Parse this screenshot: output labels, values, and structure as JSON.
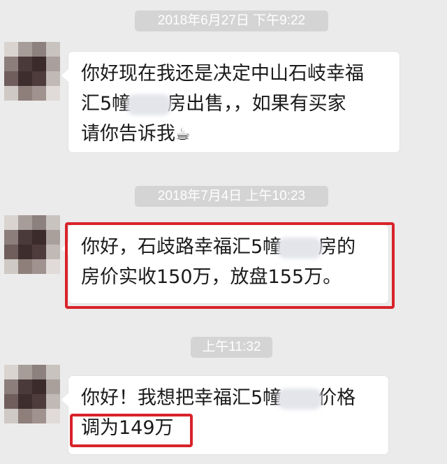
{
  "messages": [
    {
      "timestamp": "2018年6月27日 下午9:22",
      "lines": [
        "你好现在我还是决定中山石岐幸福",
        "汇5幢",
        "房出售，，如果有买家",
        "请你告诉我",
        "☕"
      ]
    },
    {
      "timestamp": "2018年7月4日 上午10:23",
      "lines": [
        "你好，石歧路幸福汇5幢",
        "房的",
        "房价实收150万，放盘155万。"
      ]
    },
    {
      "timestamp": "上午11:32",
      "lines": [
        "你好！我想把幸福汇5幢",
        "价格",
        "调为149万"
      ]
    }
  ],
  "colors": {
    "background": "#ebebeb",
    "timestamp_bg": "#d4d4d4",
    "highlight": "#d8232a",
    "bubble": "#ffffff"
  },
  "icons": {
    "avatar": "avatar-mosaic",
    "emoji": "coffee-cup-icon"
  }
}
